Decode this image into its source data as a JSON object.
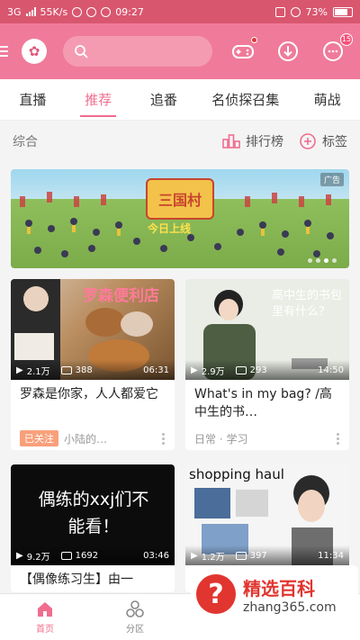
{
  "status_bar": {
    "network": "3G",
    "speed": "55K/s",
    "time": "09:27",
    "battery": "73%"
  },
  "top_bar": {
    "avatar_icon": "flower-avatar-icon",
    "search_icon": "search-icon",
    "game_icon": "gamepad-icon",
    "download_icon": "download-icon",
    "message_icon": "message-icon",
    "message_badge": "15",
    "accent": "#f07a99"
  },
  "tabs": [
    {
      "label": "直播"
    },
    {
      "label": "推荐",
      "active": true
    },
    {
      "label": "追番"
    },
    {
      "label": "名侦探召集"
    },
    {
      "label": "萌战"
    }
  ],
  "section": {
    "title": "综合",
    "ranking": "排行榜",
    "tags": "标签"
  },
  "banner": {
    "ad_label": "广告",
    "logo_text": "三国村",
    "sub_text": "今日上线"
  },
  "cards": [
    {
      "overlay": "罗森便利店",
      "views": "2.1万",
      "danmaku": "388",
      "duration": "06:31",
      "title": "罗森是你家，人人都爱它",
      "tag": "已关注",
      "meta": "小陆的…"
    },
    {
      "overlay": "高中生的书包里有什么？",
      "views": "2.9万",
      "danmaku": "293",
      "duration": "14:50",
      "title": "What's in my bag? /高中生的书…",
      "tag": "",
      "meta": "日常 · 学习"
    },
    {
      "overlay": "偶练的xxj们不能看！",
      "views": "9.2万",
      "danmaku": "1692",
      "duration": "03:46",
      "title": "【偶像练习生】由一",
      "tag": "",
      "meta": ""
    },
    {
      "overlay": "shopping haul",
      "views": "1.2万",
      "danmaku": "397",
      "duration": "11:34",
      "title": "",
      "tag": "",
      "meta": ""
    }
  ],
  "bottom_nav": [
    {
      "label": "首页",
      "icon": "home-icon",
      "active": true
    },
    {
      "label": "分区",
      "icon": "category-icon"
    }
  ],
  "watermark": {
    "mark": "?",
    "cn": "精选百科",
    "url": "zhang365.com"
  }
}
